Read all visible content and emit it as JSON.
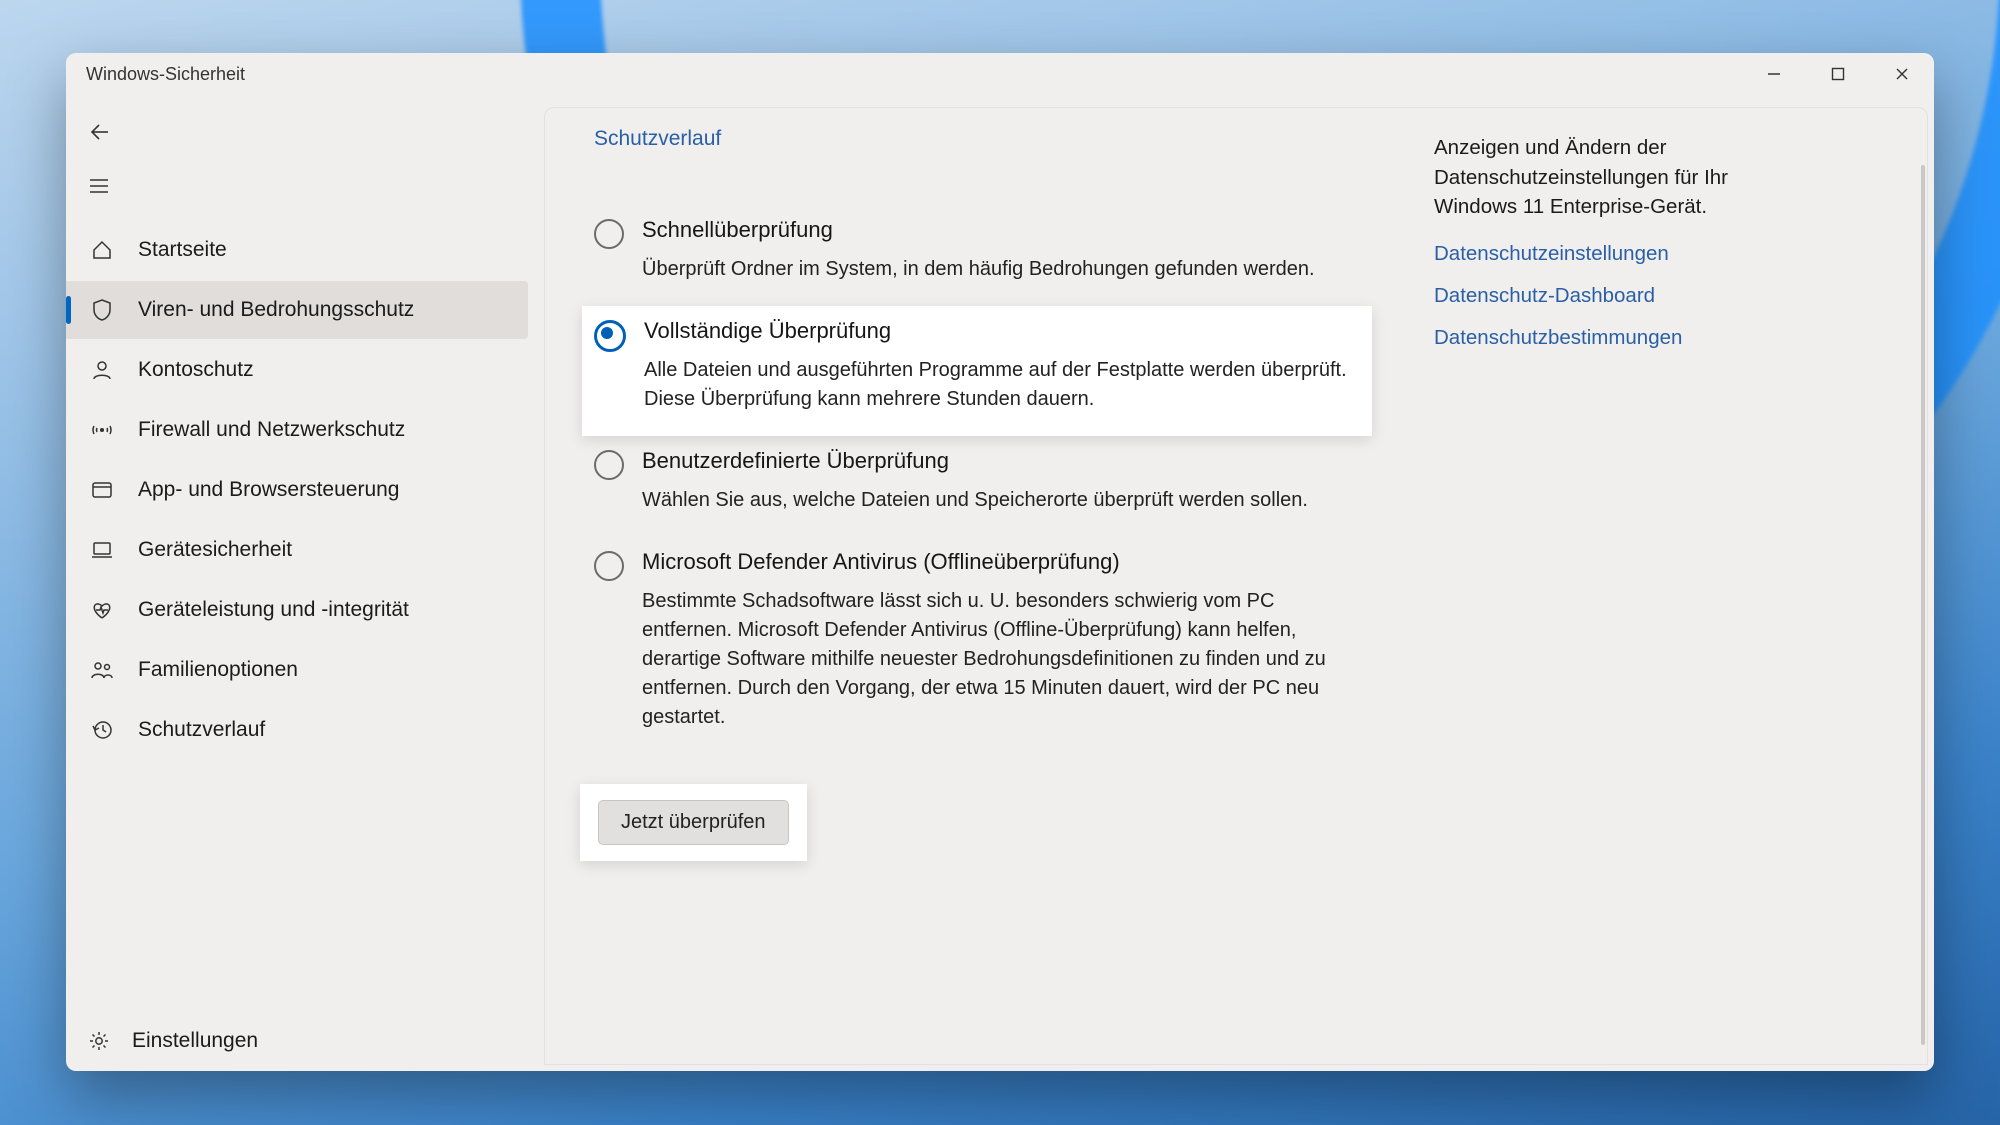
{
  "window": {
    "title": "Windows-Sicherheit"
  },
  "sidebar": {
    "items": [
      {
        "label": "Startseite"
      },
      {
        "label": "Viren- und Bedrohungsschutz"
      },
      {
        "label": "Kontoschutz"
      },
      {
        "label": "Firewall und Netzwerkschutz"
      },
      {
        "label": "App- und Browsersteuerung"
      },
      {
        "label": "Gerätesicherheit"
      },
      {
        "label": "Geräteleistung und -integrität"
      },
      {
        "label": "Familienoptionen"
      },
      {
        "label": "Schutzverlauf"
      }
    ],
    "settings": "Einstellungen"
  },
  "main": {
    "breadcrumb": "Schutzverlauf",
    "options": [
      {
        "title": "Schnellüberprüfung",
        "desc": "Überprüft Ordner im System, in dem häufig Bedrohungen gefunden werden."
      },
      {
        "title": "Vollständige Überprüfung",
        "desc": "Alle Dateien und ausgeführten Programme auf der Festplatte werden überprüft. Diese Überprüfung kann mehrere Stunden dauern."
      },
      {
        "title": "Benutzerdefinierte Überprüfung",
        "desc": "Wählen Sie aus, welche Dateien und Speicherorte überprüft werden sollen."
      },
      {
        "title": "Microsoft Defender Antivirus (Offlineüberprüfung)",
        "desc": "Bestimmte Schadsoftware lässt sich u. U. besonders schwierig vom PC entfernen. Microsoft Defender Antivirus (Offline-Überprüfung) kann helfen, derartige Software mithilfe neuester Bedrohungsdefinitionen zu finden und zu entfernen. Durch den Vorgang, der etwa 15 Minuten dauert, wird der PC neu gestartet."
      }
    ],
    "scan_button": "Jetzt überprüfen"
  },
  "privacy": {
    "desc": "Anzeigen und Ändern der Datenschutzeinstellungen für Ihr Windows 11 Enterprise-Gerät.",
    "links": [
      "Datenschutzeinstellungen",
      "Datenschutz-Dashboard",
      "Datenschutzbestimmungen"
    ]
  }
}
